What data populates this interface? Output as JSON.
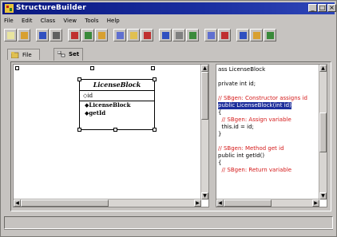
{
  "app": {
    "title": "StructureBuilder"
  },
  "window_controls": [
    "_",
    "□",
    "×"
  ],
  "menu": [
    "File",
    "Edit",
    "Class",
    "View",
    "Tools",
    "Help"
  ],
  "toolbar_icons": [
    "new-icon",
    "open-icon",
    "save-icon",
    "print-icon",
    "cut-icon",
    "copy-icon",
    "paste-icon",
    "class-icon",
    "interface-icon",
    "package-icon",
    "link-icon",
    "zoom-icon",
    "grid-icon",
    "settings-icon",
    "pencil-icon",
    "arrow-icon",
    "pointer-icon",
    "help-icon"
  ],
  "tabs": [
    {
      "label": "File View",
      "active": false
    },
    {
      "label": "Set 0",
      "active": true
    }
  ],
  "uml_class": {
    "name": "LicenseBlock",
    "attribute": "id",
    "methods": [
      "LicenseBlock",
      "getId"
    ]
  },
  "code_lines": [
    {
      "text": "ass LicenseBlock",
      "kind": "code"
    },
    {
      "text": "",
      "kind": "code"
    },
    {
      "text": "private int id;",
      "kind": "code"
    },
    {
      "text": "",
      "kind": "code"
    },
    {
      "text": "// SBgen: Constructor assigns id",
      "kind": "comment"
    },
    {
      "text": "public LicenseBlock(int id)",
      "kind": "highlight"
    },
    {
      "text": "{",
      "kind": "code"
    },
    {
      "text": "  // SBgen: Assign variable",
      "kind": "comment"
    },
    {
      "text": "  this.id = id;",
      "kind": "code"
    },
    {
      "text": "}",
      "kind": "code"
    },
    {
      "text": "",
      "kind": "code"
    },
    {
      "text": "// SBgen: Method get id",
      "kind": "comment"
    },
    {
      "text": "public int getId()",
      "kind": "code"
    },
    {
      "text": "{",
      "kind": "code"
    },
    {
      "text": "  // SBgen: Return variable",
      "kind": "comment"
    }
  ],
  "colors": {
    "titlebar": "#0a1880",
    "comment": "#d41a1a",
    "selection": "#1c2e9c"
  }
}
